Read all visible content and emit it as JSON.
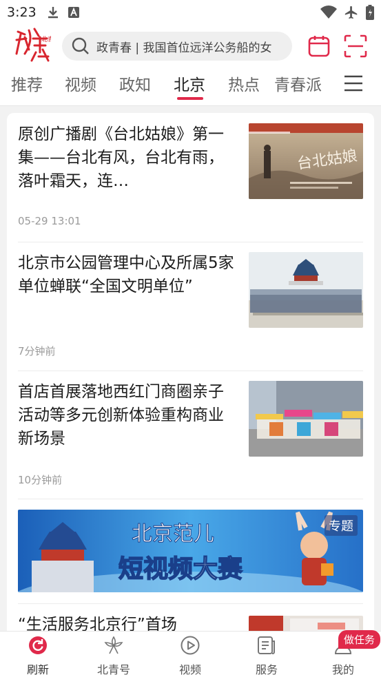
{
  "status_bar": {
    "time": "3:23",
    "icons": [
      "download-icon",
      "font-app-icon",
      "wifi-icon",
      "airplane-icon",
      "battery-icon"
    ]
  },
  "header": {
    "logo_text": "北青",
    "search_placeholder": "政青春 | 我国首位远洋公务船的女",
    "icons": [
      "search-icon",
      "calendar-icon",
      "scan-icon"
    ],
    "accent_color": "#e0294a"
  },
  "tabs": {
    "items": [
      "推荐",
      "视频",
      "政知",
      "北京",
      "热点",
      "青春派"
    ],
    "active": "北京"
  },
  "feed": {
    "items": [
      {
        "title": "原创广播剧《台北姑娘》第一集——台北有风，台北有雨，落叶霜天，连…",
        "time": "05-29 13:01",
        "thumb_text": "台北姑娘"
      },
      {
        "title": "北京市公园管理中心及所属5家单位蝉联“全国文明单位”",
        "time": "7分钟前"
      },
      {
        "title": "首店首展落地西红门商圈亲子活动等多元创新体验重构商业新场景",
        "time": "10分钟前"
      },
      {
        "title": "“生活服务北京行”首场"
      }
    ],
    "banner": {
      "text_top": "北京范儿",
      "text_main": "短视频大赛",
      "badge": "专题"
    }
  },
  "bottom_nav": {
    "items": [
      {
        "label": "刷新",
        "icon": "refresh-icon",
        "active": true
      },
      {
        "label": "北青号",
        "icon": "flower-icon",
        "active": false
      },
      {
        "label": "视频",
        "icon": "play-circle-icon",
        "active": false
      },
      {
        "label": "服务",
        "icon": "service-doc-icon",
        "active": false
      },
      {
        "label": "我的",
        "icon": "user-icon",
        "active": false
      }
    ],
    "task_badge": "做任务"
  }
}
